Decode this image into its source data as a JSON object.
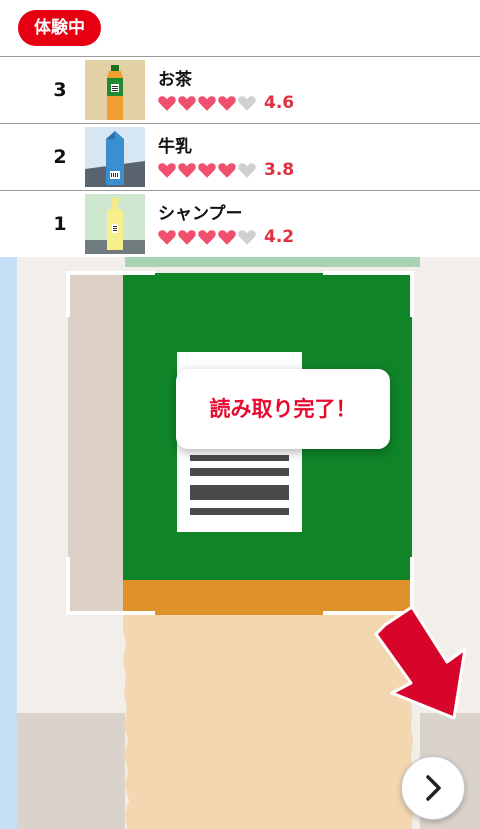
{
  "header": {
    "badge": "体験中"
  },
  "products": [
    {
      "rank": "3",
      "name": "お茶",
      "score": "4.6",
      "hearts_full": 4,
      "product_icon": "tea-bottle-icon"
    },
    {
      "rank": "2",
      "name": "牛乳",
      "score": "3.8",
      "hearts_full": 4,
      "product_icon": "milk-carton-icon"
    },
    {
      "rank": "1",
      "name": "シャンプー",
      "score": "4.2",
      "hearts_full": 4,
      "product_icon": "shampoo-bottle-icon"
    }
  ],
  "scan": {
    "complete_message": "読み取り完了！"
  },
  "navigation": {
    "next_icon": "chevron-right-icon"
  },
  "colors": {
    "accent_red": "#e60012",
    "heart_pink": "#f0506e",
    "score_red": "#e03040",
    "board_green": "#0f8528"
  }
}
